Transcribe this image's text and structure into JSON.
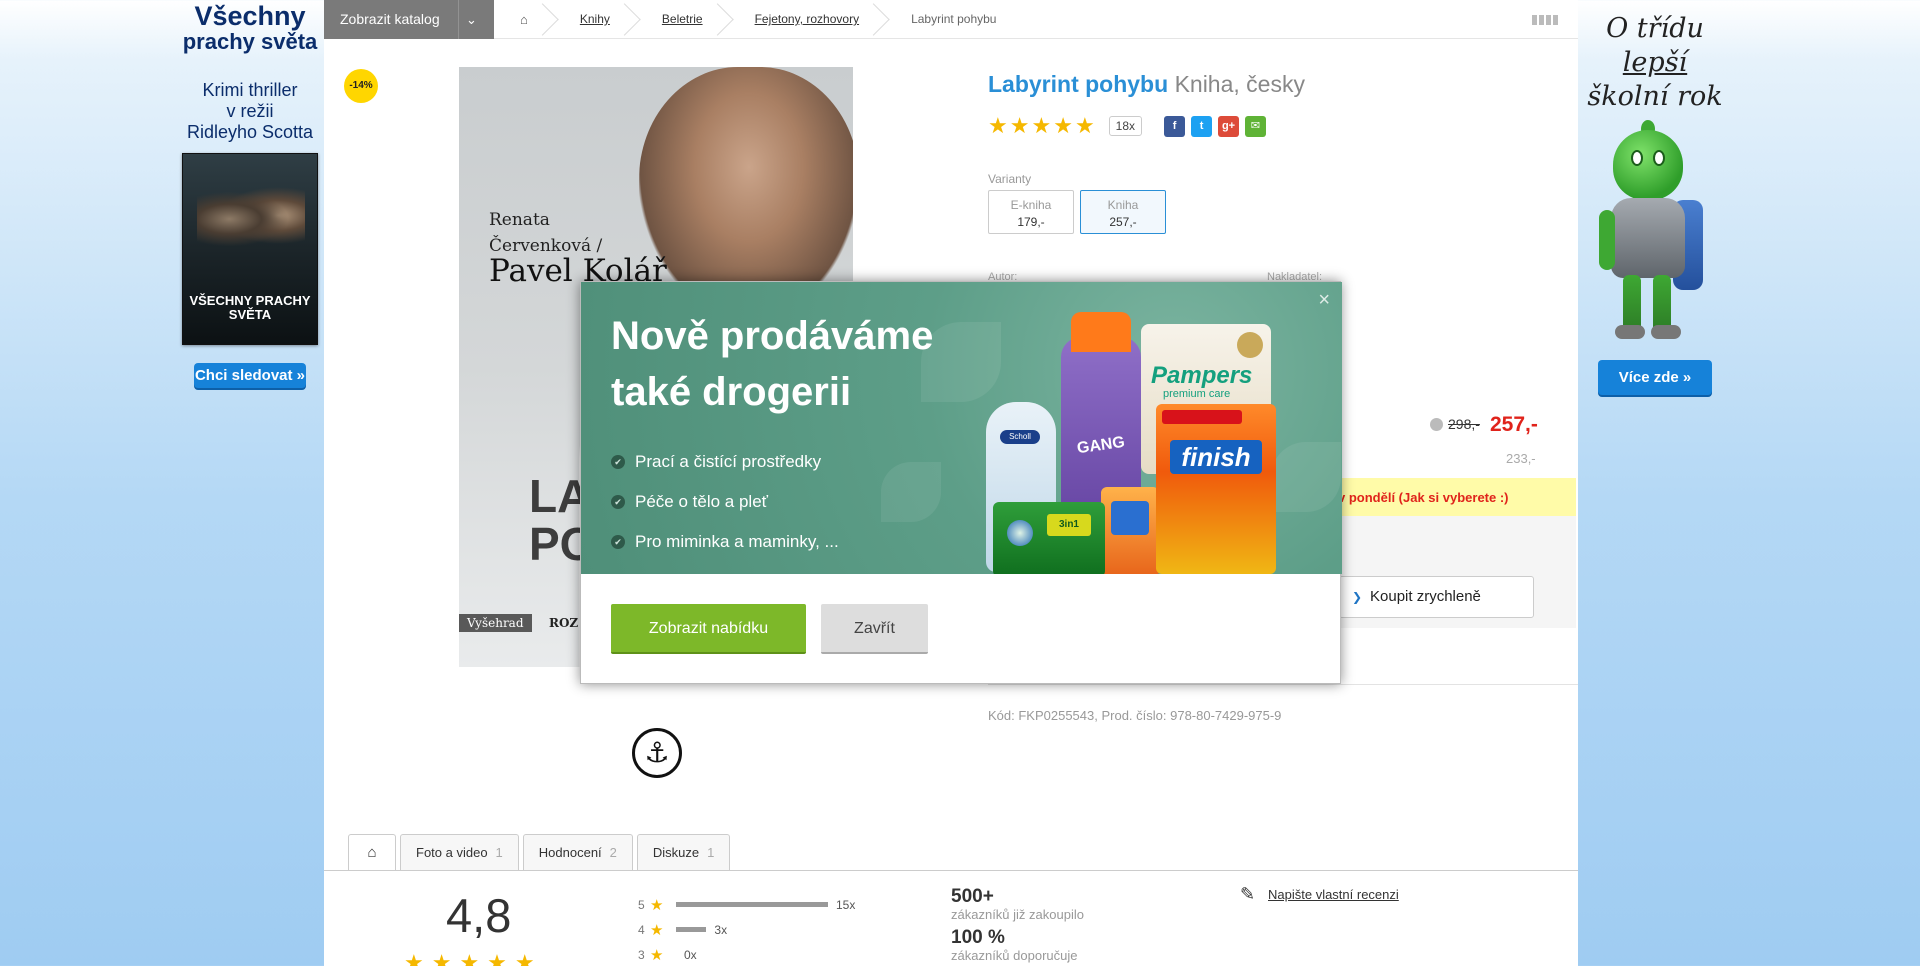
{
  "left_banner": {
    "title": "Všechny",
    "title2": "prachy světa",
    "desc": [
      "Krimi thriller",
      "v režii",
      "Ridleyho Scotta"
    ],
    "poster_title": "VŠECHNY PRACHY SVĚTA",
    "button_label": "Chci sledovat »"
  },
  "right_banner": {
    "line1_pre": "O třídu ",
    "line1_em": "lepší",
    "line2": "školní rok",
    "button_label": "Více zde »"
  },
  "topbar": {
    "catalog_label": "Zobrazit katalog",
    "breadcrumbs": [
      "Knihy",
      "Beletrie",
      "Fejetony, rozhovory"
    ],
    "current": "Labyrint pohybu"
  },
  "product": {
    "discount": "-14%",
    "cover": {
      "author1": "Renata",
      "author1b": "Červenková /",
      "author2": "Pavel Kolář",
      "big1": "LA",
      "big2": "PO",
      "publisher": "Vyšehrad",
      "publisher2": "ROZ"
    },
    "title": "Labyrint pohybu",
    "variant": "Kniha, česky",
    "rating_count": "18x",
    "variants_label": "Varianty",
    "variants": [
      {
        "name": "E-kniha",
        "price": "179,-"
      },
      {
        "name": "Kniha",
        "price": "257,-"
      }
    ],
    "author_label": "Autor:",
    "publisher_label": "Nakladatel:",
    "old_price": "298,-",
    "price": "257,-",
    "sub_price": "233,-",
    "delivery_note": "v pondělí (Jak si vyberete :)",
    "buy_fast": "Koupit zrychleně",
    "code_line": "Kód: FKP0255543,  Prod. číslo: 978-80-7429-975-9"
  },
  "tabs": [
    {
      "label": "Foto a video",
      "count": "1"
    },
    {
      "label": "Hodnocení",
      "count": "2"
    },
    {
      "label": "Diskuze",
      "count": "1"
    }
  ],
  "reviews": {
    "score": "4,8",
    "rating_5": 15,
    "rating_4": 3,
    "rating_3": 0,
    "bars": [
      {
        "stars": "5",
        "count": "15x"
      },
      {
        "stars": "4",
        "count": "3x"
      },
      {
        "stars": "3",
        "count": "0x"
      }
    ],
    "stat1_value": "500+",
    "stat1_label": "zákazníků již zakoupilo",
    "stat2_value": "100 %",
    "stat2_label": "zákazníků doporučuje",
    "write_link": "Napište vlastní recenzi"
  },
  "modal": {
    "headline1": "Nově prodáváme",
    "headline2": "také drogerii",
    "bullets": [
      "Prací a čistící prostředky",
      "Péče o tělo a pleť",
      "Pro miminka a maminky, ..."
    ],
    "cta": "Zobrazit nabídku",
    "dismiss": "Zavřít",
    "close_glyph": "×",
    "brands": {
      "scholl": "Scholl",
      "gang": "GANG",
      "pampers": "Pampers",
      "pampers_sub": "premium care",
      "finish": "finish",
      "ariel": "3in1"
    }
  },
  "colors": {
    "accent_blue": "#2a8fd6",
    "price_red": "#e0231b",
    "cta_green": "#7db829",
    "modal_teal": "#5d9e88",
    "star": "#f5b800"
  }
}
